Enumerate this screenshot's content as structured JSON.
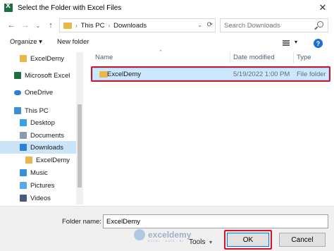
{
  "window": {
    "title": "Select the Folder with Excel Files",
    "close_glyph": "✕"
  },
  "address_bar": {
    "crumbs": [
      "This PC",
      "Downloads"
    ],
    "search_placeholder": "Search Downloads"
  },
  "toolbar": {
    "organize_label": "Organize ▾",
    "new_folder_label": "New folder",
    "help_label": "?"
  },
  "sidebar": {
    "items": [
      {
        "label": "ExcelDemy",
        "icon": "folder-icon"
      },
      {
        "label": "Microsoft Excel",
        "icon": "excel-icon"
      },
      {
        "label": "OneDrive",
        "icon": "onedrive-icon"
      },
      {
        "label": "This PC",
        "icon": "pc-icon"
      },
      {
        "label": "Desktop",
        "icon": "desktop-icon"
      },
      {
        "label": "Documents",
        "icon": "documents-icon"
      },
      {
        "label": "Downloads",
        "icon": "downloads-icon",
        "selected": true
      },
      {
        "label": "ExcelDemy",
        "icon": "folder-icon"
      },
      {
        "label": "Music",
        "icon": "music-icon"
      },
      {
        "label": "Pictures",
        "icon": "pictures-icon"
      },
      {
        "label": "Videos",
        "icon": "videos-icon"
      }
    ]
  },
  "columns": [
    "Name",
    "Date modified",
    "Type"
  ],
  "files": [
    {
      "name": "ExcelDemy",
      "date": "5/19/2022 1:00 PM",
      "type": "File folder"
    }
  ],
  "footer": {
    "folder_name_label": "Folder name:",
    "folder_name_value": "ExcelDemy",
    "tools_label": "Tools",
    "ok_label": "OK",
    "cancel_label": "Cancel"
  },
  "watermark": {
    "brand": "exceldemy",
    "tagline": "EXCEL · DATA · BI"
  },
  "colors": {
    "selection": "#cce8ff",
    "highlight_border": "#d0142c",
    "accent": "#0078d7"
  }
}
